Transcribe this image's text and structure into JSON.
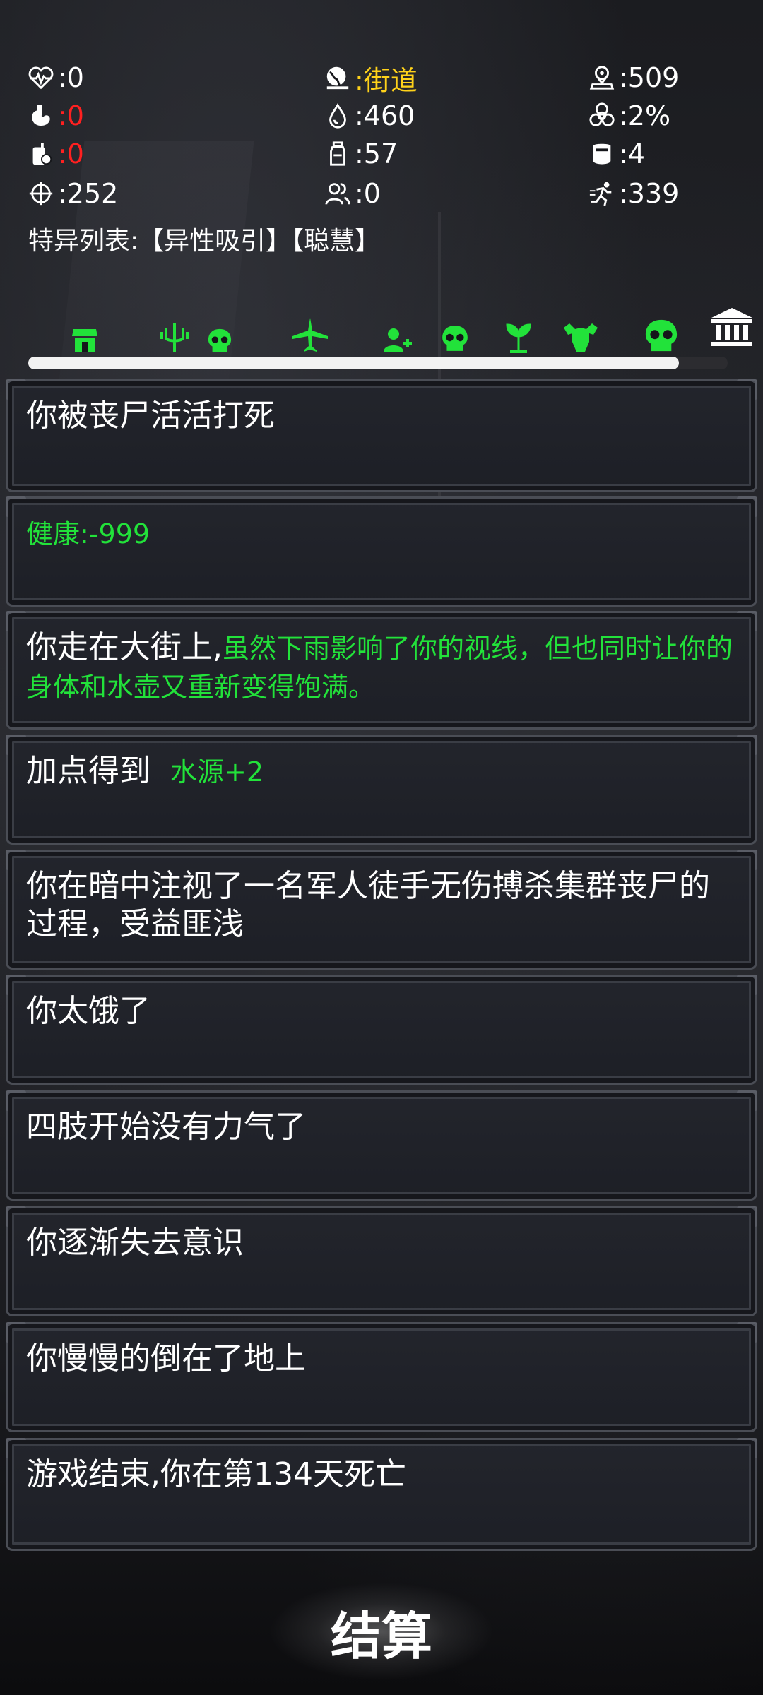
{
  "stats": {
    "health": ":0",
    "hunger": ":0",
    "thirst": ":0",
    "attack": ":252",
    "location": ":街道",
    "water": ":460",
    "bottle": ":57",
    "team": ":0",
    "distance": ":509",
    "infection": ":2%",
    "armor": ":4",
    "speed": ":339"
  },
  "traits_label": "特异列表:【异性吸引】【聪慧】",
  "timeline": {
    "progress": 0.93,
    "icons": [
      "shop-icon",
      "trident-icon",
      "skull-icon",
      "plane-icon",
      "add-user-icon",
      "skull-icon",
      "plant-icon",
      "muscle-icon",
      "skull-icon",
      "bank-icon"
    ]
  },
  "colors": {
    "green": "#22e23a",
    "red": "#ff2020",
    "yellow": "#ffd21a"
  },
  "log": {
    "e1": "你被丧尸活活打死",
    "e2": "健康:-999",
    "e3_a": "你走在大街上,",
    "e3_b": "虽然下雨影响了你的视线，但也同时让你的身体和水壶又重新变得饱满。",
    "e4_a": "加点得到",
    "e4_b": "水源+2",
    "e5": "你在暗中注视了一名军人徒手无伤搏杀集群丧尸的过程，受益匪浅",
    "e6": "你太饿了",
    "e7": "四肢开始没有力气了",
    "e8": "你逐渐失去意识",
    "e9": "你慢慢的倒在了地上",
    "e10": "游戏结束,你在第134天死亡"
  },
  "settle_button": "结算"
}
